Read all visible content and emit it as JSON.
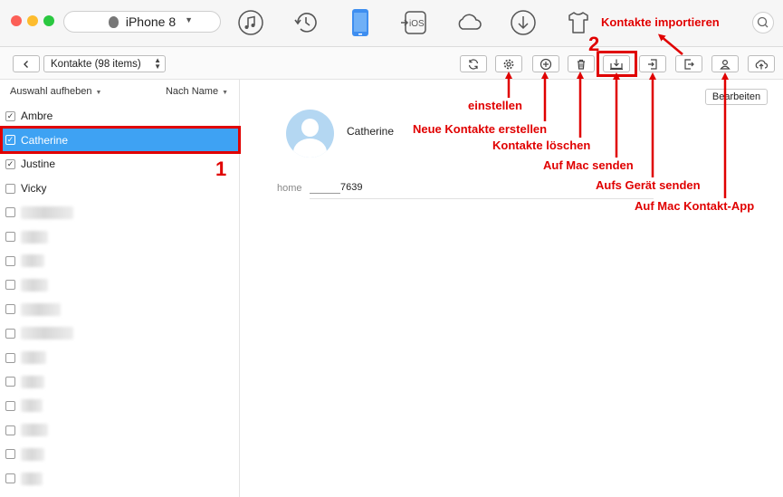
{
  "window": {
    "device": "iPhone 8",
    "top_icons": [
      "music-icon",
      "history-icon",
      "phone-icon",
      "ios-transfer-icon",
      "cloud-icon",
      "download-icon",
      "shirt-icon"
    ],
    "top_ios_label": "iOS"
  },
  "toolbar": {
    "contacts_select": "Kontakte (98 items)"
  },
  "sidebar": {
    "deselect_all": "Auswahl aufheben",
    "sort_by": "Nach Name",
    "contacts": [
      {
        "name": "Ambre",
        "checked": true,
        "selected": false
      },
      {
        "name": "Catherine",
        "checked": true,
        "selected": true
      },
      {
        "name": "Justine",
        "checked": true,
        "selected": false
      },
      {
        "name": "Vicky",
        "checked": false,
        "selected": false
      }
    ],
    "redacted_rows": 12
  },
  "detail": {
    "edit_button": "Bearbeiten",
    "name": "Catherine",
    "fields": [
      {
        "label": "home",
        "value_suffix": "7639"
      }
    ]
  },
  "annotations": {
    "step1": "1",
    "step2": "2",
    "kontakte_importieren": "Kontakte importieren",
    "einstellen": "einstellen",
    "neue_kontakte_erstellen": "Neue Kontakte erstellen",
    "kontakte_loeschen": "Kontakte löschen",
    "auf_mac_senden": "Auf Mac senden",
    "aufs_geraet_senden": "Aufs Gerät senden",
    "auf_mac_kontakt_app": "Auf Mac Kontakt-App",
    "color": "#e00000"
  },
  "colors": {
    "selection": "#3ea2f3",
    "accent": "#3e8ef0"
  }
}
